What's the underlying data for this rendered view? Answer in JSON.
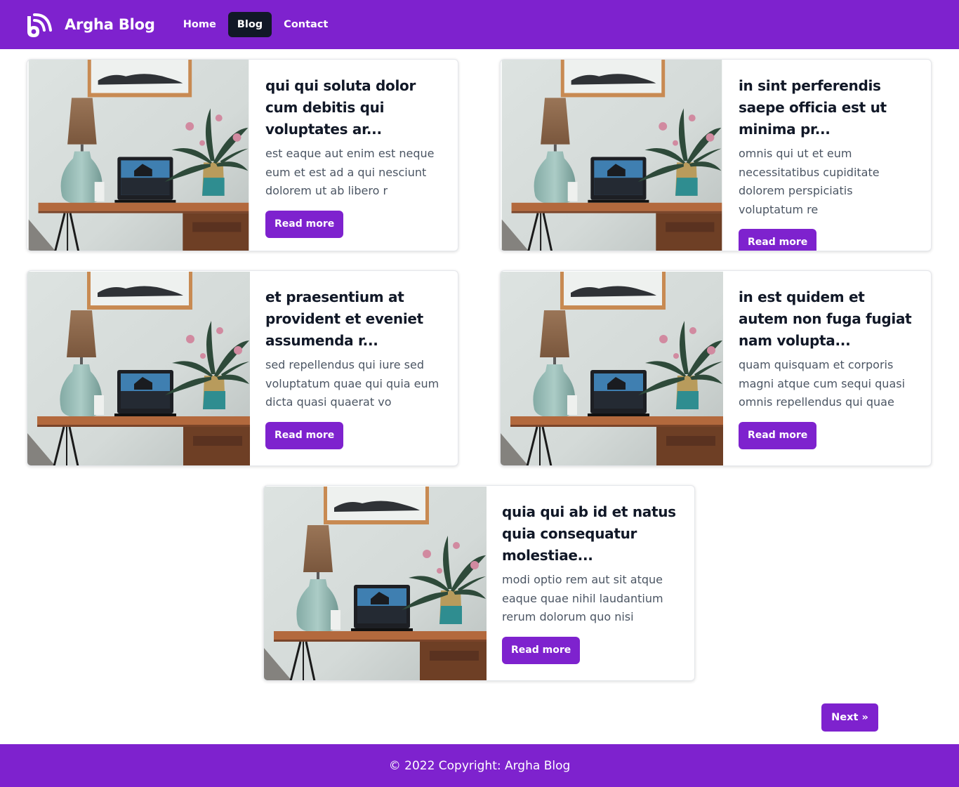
{
  "brand": {
    "name": "Argha Blog",
    "logo_icon": "blogger-logo-icon"
  },
  "nav": [
    {
      "label": "Home",
      "active": false
    },
    {
      "label": "Blog",
      "active": true
    },
    {
      "label": "Contact",
      "active": false
    }
  ],
  "posts": [
    {
      "title": "qui qui soluta dolor cum debitis qui voluptates ar...",
      "excerpt": "est eaque aut enim est neque eum et est ad a qui nesciunt dolorem ut ab libero r",
      "button": "Read more"
    },
    {
      "title": "in sint perferendis saepe officia est ut minima pr...",
      "excerpt": "omnis qui ut et eum necessitatibus cupiditate dolorem perspiciatis voluptatum re",
      "button": "Read more"
    },
    {
      "title": "et praesentium at provident et eveniet assumenda r...",
      "excerpt": "sed repellendus qui iure sed voluptatum quae qui quia eum dicta quasi quaerat vo",
      "button": "Read more"
    },
    {
      "title": "in est quidem et autem non fuga fugiat nam volupta...",
      "excerpt": "quam quisquam et corporis magni atque cum sequi quasi omnis repellendus qui quae",
      "button": "Read more"
    },
    {
      "title": "quia qui ab id et natus quia consequatur molestiae...",
      "excerpt": "modi optio rem aut sit atque eaque quae nihil laudantium rerum dolorum quo nisi",
      "button": "Read more"
    }
  ],
  "pagination": {
    "next_label": "Next »"
  },
  "footer": {
    "text": "© 2022 Copyright: Argha Blog"
  },
  "colors": {
    "primary": "#7e22ce",
    "nav_active": "#111827",
    "text": "#111827",
    "muted": "#4b5563"
  }
}
